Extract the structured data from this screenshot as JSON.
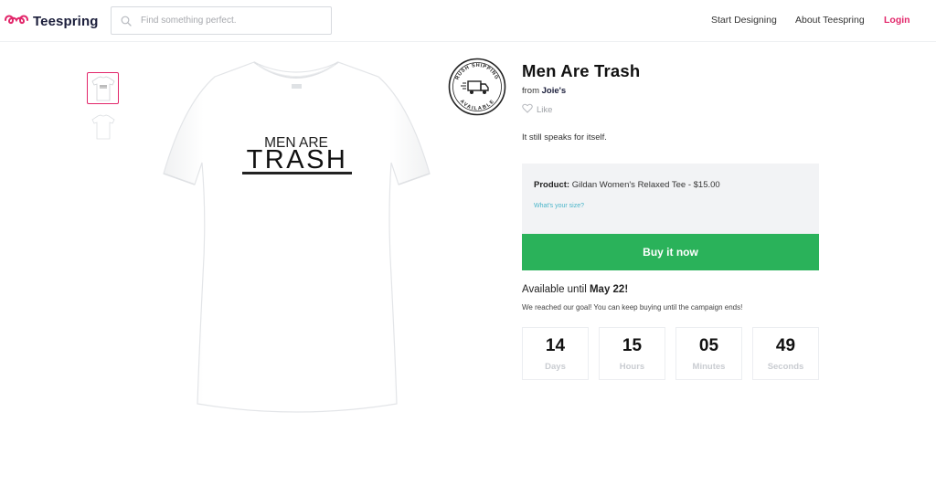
{
  "header": {
    "brand": "Teespring",
    "search_placeholder": "Find something perfect.",
    "nav": [
      "Start Designing",
      "About Teespring",
      "Login"
    ]
  },
  "product": {
    "title": "Men Are Trash",
    "from_label": "from",
    "seller": "Joie's",
    "like_label": "Like",
    "description": "It still speaks for itself.",
    "product_label": "Product:",
    "product_value": "Gildan Women's Relaxed Tee - $15.00",
    "size_link": "What's your size?",
    "buy_label": "Buy it now",
    "shirt_text_top": "MEN ARE",
    "shirt_text_bottom": "TRASH",
    "badge_top": "RUSH SHIPPING",
    "badge_bottom": "AVAILABLE"
  },
  "availability": {
    "prefix": "Available until",
    "date": "May 22!",
    "goal_message": "We reached our goal! You can keep buying until the campaign ends!"
  },
  "countdown": [
    {
      "value": "14",
      "unit": "Days"
    },
    {
      "value": "15",
      "unit": "Hours"
    },
    {
      "value": "05",
      "unit": "Minutes"
    },
    {
      "value": "49",
      "unit": "Seconds"
    }
  ],
  "colors": {
    "accent": "#e2266a",
    "buy_button": "#2ab25a",
    "link": "#4ab5c9"
  },
  "icons": [
    "teespring-logo-icon",
    "search-icon",
    "heart-icon",
    "truck-icon"
  ]
}
